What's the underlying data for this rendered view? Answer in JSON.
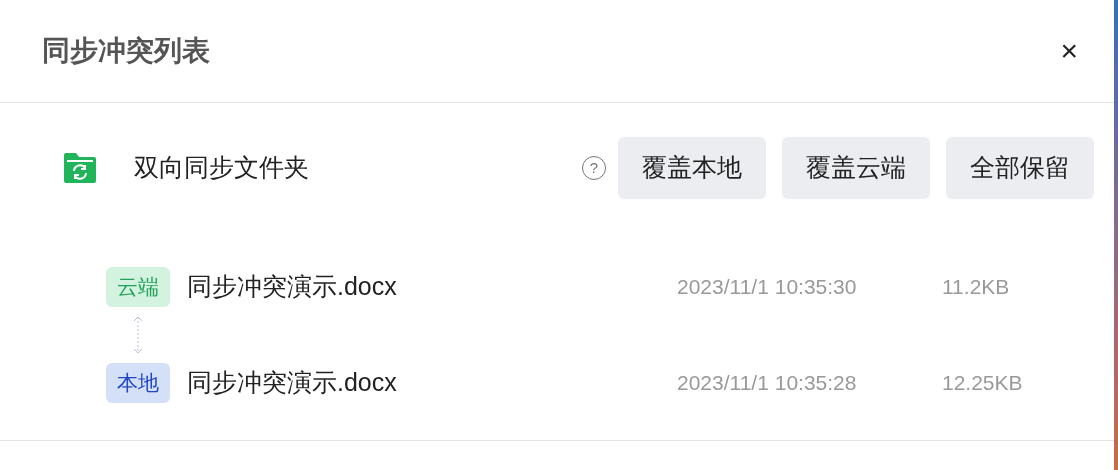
{
  "dialog": {
    "title": "同步冲突列表",
    "close": "×"
  },
  "folder": {
    "name": "双向同步文件夹",
    "help": "?"
  },
  "buttons": [
    "覆盖本地",
    "覆盖云端",
    "全部保留"
  ],
  "files": [
    {
      "kind": "cloud",
      "tag": "云端",
      "name": "同步冲突演示.docx",
      "time": "2023/11/1 10:35:30",
      "size": "11.2KB"
    },
    {
      "kind": "local",
      "tag": "本地",
      "name": "同步冲突演示.docx",
      "time": "2023/11/1 10:35:28",
      "size": "12.25KB"
    }
  ]
}
